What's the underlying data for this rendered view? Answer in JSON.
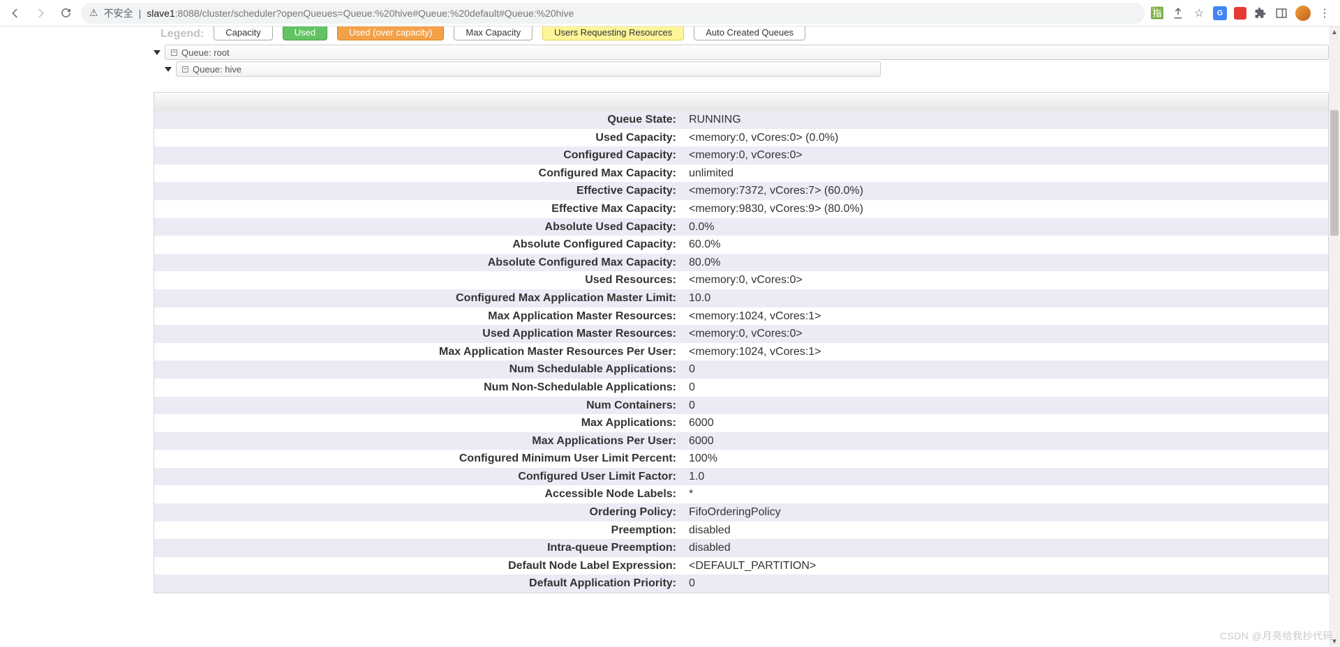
{
  "browser": {
    "security_label": "不安全",
    "url_host": "slave1",
    "url_rest": ":8088/cluster/scheduler?openQueues=Queue:%20hive#Queue:%20default#Queue:%20hive"
  },
  "legend": {
    "label": "Legend:",
    "capacity": "Capacity",
    "used": "Used",
    "used_over": "Used (over capacity)",
    "max_capacity": "Max Capacity",
    "users_req": "Users Requesting Resources",
    "auto_created": "Auto Created Queues"
  },
  "tree": {
    "root_label": "Queue: root",
    "hive_label": "Queue: hive"
  },
  "details": {
    "rows": [
      {
        "k": "Queue State:",
        "v": "RUNNING"
      },
      {
        "k": "Used Capacity:",
        "v": "<memory:0, vCores:0> (0.0%)"
      },
      {
        "k": "Configured Capacity:",
        "v": "<memory:0, vCores:0>"
      },
      {
        "k": "Configured Max Capacity:",
        "v": "unlimited"
      },
      {
        "k": "Effective Capacity:",
        "v": "<memory:7372, vCores:7> (60.0%)"
      },
      {
        "k": "Effective Max Capacity:",
        "v": "<memory:9830, vCores:9> (80.0%)"
      },
      {
        "k": "Absolute Used Capacity:",
        "v": "0.0%"
      },
      {
        "k": "Absolute Configured Capacity:",
        "v": "60.0%"
      },
      {
        "k": "Absolute Configured Max Capacity:",
        "v": "80.0%"
      },
      {
        "k": "Used Resources:",
        "v": "<memory:0, vCores:0>"
      },
      {
        "k": "Configured Max Application Master Limit:",
        "v": "10.0"
      },
      {
        "k": "Max Application Master Resources:",
        "v": "<memory:1024, vCores:1>"
      },
      {
        "k": "Used Application Master Resources:",
        "v": "<memory:0, vCores:0>"
      },
      {
        "k": "Max Application Master Resources Per User:",
        "v": "<memory:1024, vCores:1>"
      },
      {
        "k": "Num Schedulable Applications:",
        "v": "0"
      },
      {
        "k": "Num Non-Schedulable Applications:",
        "v": "0"
      },
      {
        "k": "Num Containers:",
        "v": "0"
      },
      {
        "k": "Max Applications:",
        "v": "6000"
      },
      {
        "k": "Max Applications Per User:",
        "v": "6000"
      },
      {
        "k": "Configured Minimum User Limit Percent:",
        "v": "100%"
      },
      {
        "k": "Configured User Limit Factor:",
        "v": "1.0"
      },
      {
        "k": "Accessible Node Labels:",
        "v": "*"
      },
      {
        "k": "Ordering Policy:",
        "v": "FifoOrderingPolicy"
      },
      {
        "k": "Preemption:",
        "v": "disabled"
      },
      {
        "k": "Intra-queue Preemption:",
        "v": "disabled"
      },
      {
        "k": "Default Node Label Expression:",
        "v": "<DEFAULT_PARTITION>"
      },
      {
        "k": "Default Application Priority:",
        "v": "0"
      }
    ]
  },
  "watermark": "CSDN @月亮给我抄代码"
}
